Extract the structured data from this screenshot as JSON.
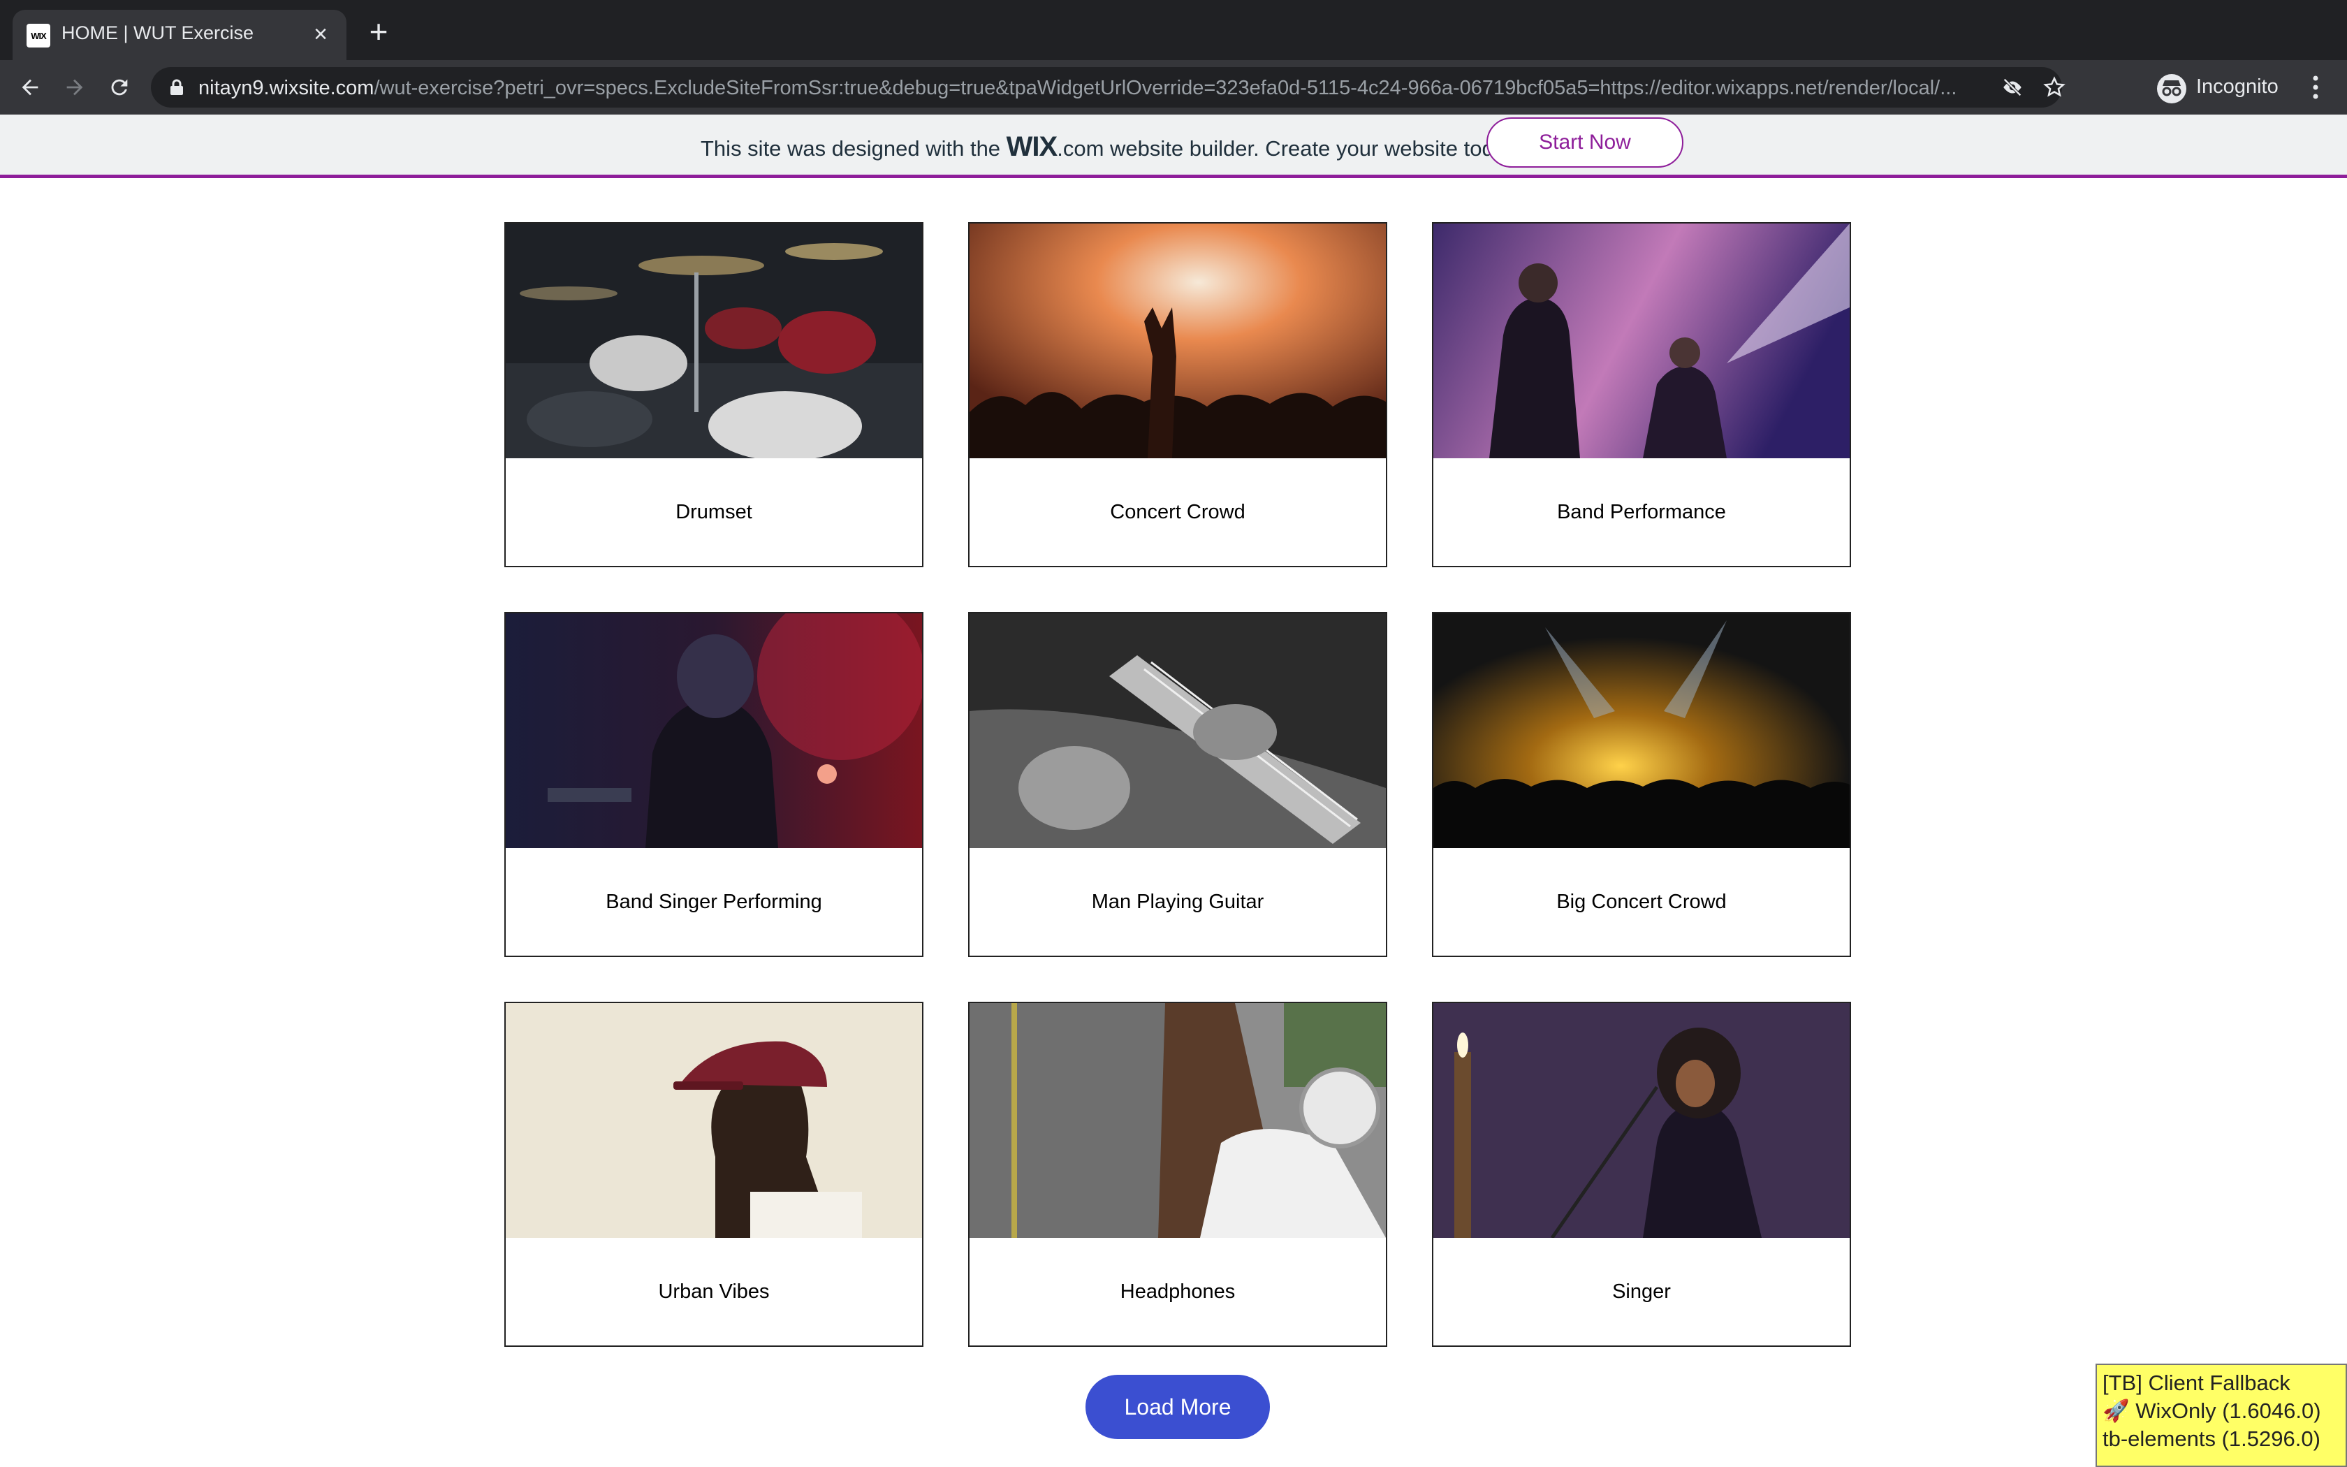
{
  "browser": {
    "tab_title": "HOME | WUT Exercise",
    "tab_favicon": "WIX",
    "url_host": "nitayn9.wixsite.com",
    "url_path": "/wut-exercise?petri_ovr=specs.ExcludeSiteFromSsr:true&debug=true&tpaWidgetUrlOverride=323efa0d-5115-4c24-966a-06719bcf05a5=https://editor.wixapps.net/render/local/...",
    "profile_label": "Incognito"
  },
  "wix_banner": {
    "text_before": "This site was designed with the ",
    "logo": "WIX",
    "text_after": ".com website builder. Create your website today.",
    "cta": "Start Now"
  },
  "gallery": {
    "items": [
      {
        "title": "Drumset"
      },
      {
        "title": "Concert Crowd"
      },
      {
        "title": "Band Performance"
      },
      {
        "title": "Band Singer Performing"
      },
      {
        "title": "Man Playing Guitar"
      },
      {
        "title": "Big Concert Crowd"
      },
      {
        "title": "Urban Vibes"
      },
      {
        "title": "Headphones"
      },
      {
        "title": "Singer"
      }
    ],
    "load_more": "Load More"
  },
  "debug_panel": {
    "line1": "[TB] Client Fallback",
    "line2": "🚀 WixOnly (1.6046.0)",
    "line3": "tb-elements (1.5296.0)"
  },
  "colors": {
    "wix_accent": "#8e1e9a",
    "load_more": "#3b4fd1",
    "debug_bg": "#ffff66"
  }
}
